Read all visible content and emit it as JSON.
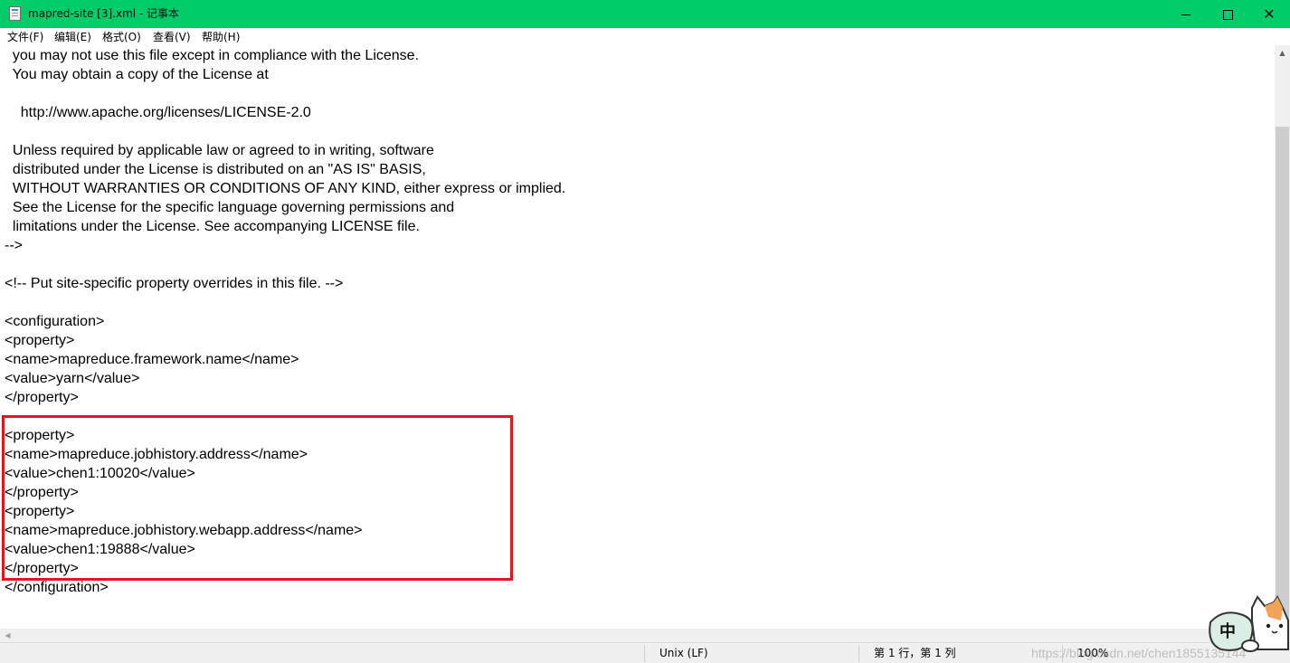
{
  "window": {
    "title": "mapred-site [3].xml - 记事本",
    "title_bar_color": "#00cc6a",
    "controls": {
      "minimize_icon": "minimize-icon",
      "maximize_icon": "maximize-icon",
      "close_icon": "close-icon",
      "close_glyph": "✕"
    }
  },
  "menu": [
    {
      "label": "文件(F)"
    },
    {
      "label": "编辑(E)"
    },
    {
      "label": "格式(O)"
    },
    {
      "label": "查看(V)"
    },
    {
      "label": "帮助(H)"
    }
  ],
  "editor": {
    "lines": [
      "  you may not use this file except in compliance with the License.",
      "  You may obtain a copy of the License at",
      "",
      "    http://www.apache.org/licenses/LICENSE-2.0",
      "",
      "  Unless required by applicable law or agreed to in writing, software",
      "  distributed under the License is distributed on an \"AS IS\" BASIS,",
      "  WITHOUT WARRANTIES OR CONDITIONS OF ANY KIND, either express or implied.",
      "  See the License for the specific language governing permissions and",
      "  limitations under the License. See accompanying LICENSE file.",
      "-->",
      "",
      "<!-- Put site-specific property overrides in this file. -->",
      "",
      "<configuration>",
      "<property>",
      "<name>mapreduce.framework.name</name>",
      "<value>yarn</value>",
      "</property>",
      "",
      "<property>",
      "<name>mapreduce.jobhistory.address</name>",
      "<value>chen1:10020</value>",
      "</property>",
      "<property>",
      "<name>mapreduce.jobhistory.webapp.address</name>",
      "<value>chen1:19888</value>",
      "</property>",
      "</configuration>"
    ],
    "highlight_color": "#e8141b"
  },
  "status": {
    "line_ending": "Unix (LF)",
    "position": "第 1 行，第 1 列",
    "zoom": "100%",
    "watermark": "https://blog.csdn.net/chen1855135144"
  },
  "ime": {
    "label": "中",
    "icon": "cat-mascot-icon"
  }
}
